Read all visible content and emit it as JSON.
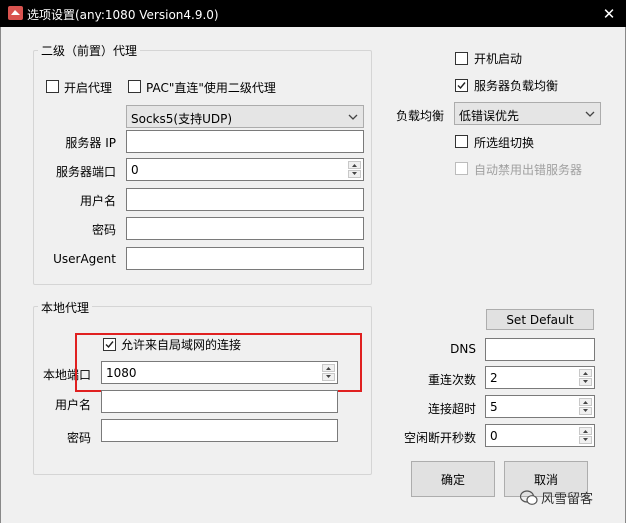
{
  "window": {
    "title": "选项设置(any:1080 Version4.9.0)",
    "close_glyph": "✕"
  },
  "second_proxy": {
    "group_title": "二级（前置）代理",
    "enable_label": "开启代理",
    "enable_checked": false,
    "pac_label": "PAC\"直连\"使用二级代理",
    "pac_checked": false,
    "type_value": "Socks5(支持UDP)",
    "server_ip_label": "服务器 IP",
    "server_ip_value": "",
    "server_port_label": "服务器端口",
    "server_port_value": "0",
    "username_label": "用户名",
    "username_value": "",
    "password_label": "密码",
    "password_value": "",
    "useragent_label": "UserAgent",
    "useragent_value": ""
  },
  "right_options": {
    "autostart_label": "开机启动",
    "autostart_checked": false,
    "lb_enable_label": "服务器负载均衡",
    "lb_enable_checked": true,
    "lb_label": "负载均衡",
    "lb_value": "低错误优先",
    "group_switch_label": "所选组切换",
    "group_switch_checked": false,
    "auto_disable_label": "自动禁用出错服务器",
    "auto_disable_checked": false
  },
  "local_proxy": {
    "group_title": "本地代理",
    "allow_lan_label": "允许来自局域网的连接",
    "allow_lan_checked": true,
    "port_label": "本地端口",
    "port_value": "1080",
    "username_label": "用户名",
    "username_value": "",
    "password_label": "密码",
    "password_value": ""
  },
  "network": {
    "set_default_label": "Set Default",
    "dns_label": "DNS",
    "dns_value": "",
    "reconnect_label": "重连次数",
    "reconnect_value": "2",
    "timeout_label": "连接超时",
    "timeout_value": "5",
    "idle_label": "空闲断开秒数",
    "idle_value": "0"
  },
  "buttons": {
    "ok_label": "确定",
    "cancel_label": "取消"
  },
  "watermark": {
    "text": "风雪留客"
  },
  "colors": {
    "highlight": "#e02020",
    "titlebar": "#000000",
    "dialog_bg": "#f0f0f0"
  }
}
